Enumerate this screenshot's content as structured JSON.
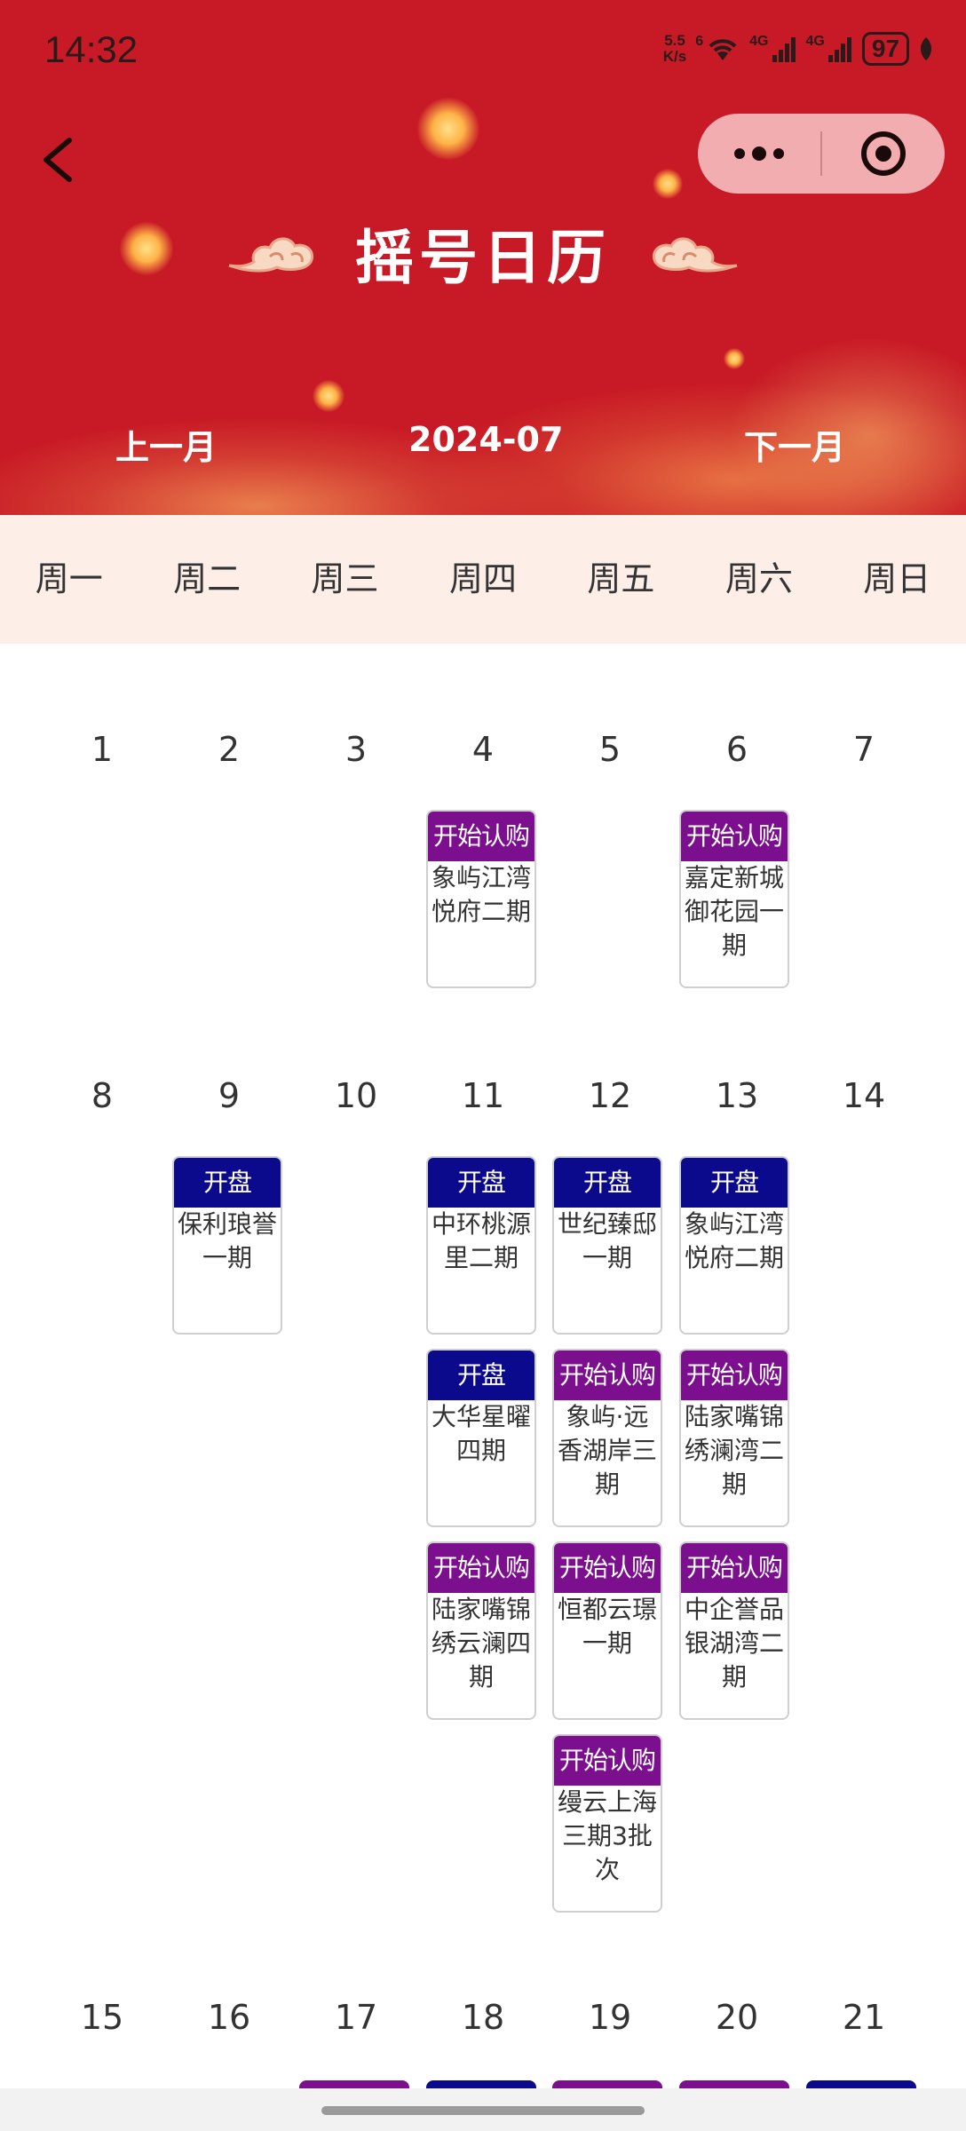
{
  "status_bar": {
    "time": "14:32",
    "net_speed_value": "5.5",
    "net_speed_unit": "K/s",
    "wifi_label": "6",
    "signal1_label": "4G",
    "signal2_label": "4G",
    "battery": "97"
  },
  "header": {
    "title": "摇号日历",
    "prev_month": "上一月",
    "current_month": "2024-07",
    "next_month": "下一月"
  },
  "weekdays": [
    "周一",
    "周二",
    "周三",
    "周四",
    "周五",
    "周六",
    "周日"
  ],
  "weeks": [
    {
      "days": [
        "1",
        "2",
        "3",
        "4",
        "5",
        "6",
        "7"
      ]
    },
    {
      "days": [
        "8",
        "9",
        "10",
        "11",
        "12",
        "13",
        "14"
      ]
    },
    {
      "days": [
        "15",
        "16",
        "17",
        "18",
        "19",
        "20",
        "21"
      ]
    }
  ],
  "events": [
    {
      "tag": "开始认购",
      "type": "buy",
      "name": "象屿江湾悦府二期",
      "line1": "象屿江湾",
      "line2": "悦府二期",
      "line3": ""
    },
    {
      "tag": "开始认购",
      "type": "buy",
      "name": "嘉定新城御花园一期",
      "line1": "嘉定新城",
      "line2": "御花园一",
      "line3": "期"
    },
    {
      "tag": "开盘",
      "type": "open",
      "name": "保利琅誉一期",
      "line1": "保利琅誉",
      "line2": "一期",
      "line3": ""
    },
    {
      "tag": "开盘",
      "type": "open",
      "name": "中环桃源里二期",
      "line1": "中环桃源",
      "line2": "里二期",
      "line3": ""
    },
    {
      "tag": "开盘",
      "type": "open",
      "name": "世纪臻邸一期",
      "line1": "世纪臻邸",
      "line2": "一期",
      "line3": ""
    },
    {
      "tag": "开盘",
      "type": "open",
      "name": "象屿江湾悦府二期",
      "line1": "象屿江湾",
      "line2": "悦府二期",
      "line3": ""
    },
    {
      "tag": "开盘",
      "type": "open",
      "name": "大华星曜四期",
      "line1": "大华星曜",
      "line2": "四期",
      "line3": ""
    },
    {
      "tag": "开始认购",
      "type": "buy",
      "name": "象屿·远香湖岸三期",
      "line1": "象屿·远",
      "line2": "香湖岸三",
      "line3": "期"
    },
    {
      "tag": "开始认购",
      "type": "buy",
      "name": "陆家嘴锦绣澜湾二期",
      "line1": "陆家嘴锦",
      "line2": "绣澜湾二",
      "line3": "期"
    },
    {
      "tag": "开始认购",
      "type": "buy",
      "name": "陆家嘴锦绣云澜四期",
      "line1": "陆家嘴锦",
      "line2": "绣云澜四",
      "line3": "期"
    },
    {
      "tag": "开始认购",
      "type": "buy",
      "name": "恒都云璟一期",
      "line1": "恒都云璟",
      "line2": "一期",
      "line3": ""
    },
    {
      "tag": "开始认购",
      "type": "buy",
      "name": "中企誉品银湖湾二期",
      "line1": "中企誉品",
      "line2": "银湖湾二",
      "line3": "期"
    },
    {
      "tag": "开始认购",
      "type": "buy",
      "name": "缦云上海三期3批次",
      "line1": "缦云上海",
      "line2": "三期3批",
      "line3": "次"
    }
  ],
  "colors": {
    "header_red": "#c81a26",
    "tag_buy": "#7b0f8e",
    "tag_open": "#0b0a8c",
    "weekday_bg": "#fdeee8"
  },
  "icons": [
    "back-icon",
    "more-icon",
    "close-target-icon",
    "cloud-left-icon",
    "cloud-right-icon",
    "wifi-icon",
    "signal-icon",
    "battery-icon",
    "leaf-icon"
  ]
}
